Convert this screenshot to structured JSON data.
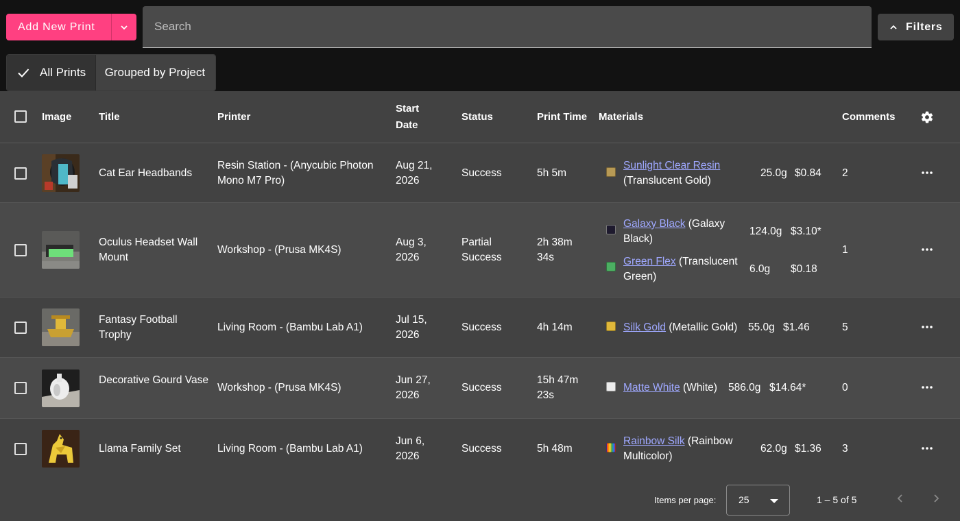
{
  "toolbar": {
    "add_label": "Add New Print",
    "search_placeholder": "Search",
    "filters_label": "Filters"
  },
  "view_toggle": {
    "all_label": "All Prints",
    "grouped_label": "Grouped by Project",
    "selected": "All Prints"
  },
  "table": {
    "headers": {
      "image": "Image",
      "title": "Title",
      "printer": "Printer",
      "start_date_line1": "Start",
      "start_date_line2": "Date",
      "status": "Status",
      "print_time": "Print Time",
      "materials": "Materials",
      "comments": "Comments"
    },
    "rows": [
      {
        "title": "Cat Ear Headbands",
        "printer": "Resin Station - (Anycubic Photon Mono M7 Pro)",
        "start_date": "Aug 21, 2026",
        "status": "Success",
        "print_time": "5h 5m",
        "materials": [
          {
            "name": "Sunlight Clear Resin",
            "detail": "(Translucent Gold)",
            "weight": "25.0g",
            "cost": "$0.84",
            "color": "#b89a55"
          }
        ],
        "comments": "2"
      },
      {
        "title": "Oculus Headset Wall Mount",
        "printer": "Workshop - (Prusa MK4S)",
        "start_date": "Aug 3, 2026",
        "status": "Partial Success",
        "print_time": "2h 38m 34s",
        "materials": [
          {
            "name": "Galaxy Black",
            "detail": "(Galaxy Black)",
            "weight": "124.0g",
            "cost": "$3.10*",
            "color": "#1e1a2e"
          },
          {
            "name": "Green Flex",
            "detail": "(Translucent Green)",
            "weight": "6.0g",
            "cost": "$0.18",
            "color": "#4caf62"
          }
        ],
        "comments": "1"
      },
      {
        "title": "Fantasy Football Trophy",
        "printer": "Living Room - (Bambu Lab A1)",
        "start_date": "Jul 15, 2026",
        "status": "Success",
        "print_time": "4h 14m",
        "materials": [
          {
            "name": "Silk Gold",
            "detail": "(Metallic Gold)",
            "weight": "55.0g",
            "cost": "$1.46",
            "color": "#e0b83a"
          }
        ],
        "comments": "5"
      },
      {
        "title": "Decorative Gourd Vase",
        "printer": "Workshop - (Prusa MK4S)",
        "start_date": "Jun 27, 2026",
        "status": "Success",
        "print_time": "15h 47m 23s",
        "materials": [
          {
            "name": "Matte White",
            "detail": "(White)",
            "weight": "586.0g",
            "cost": "$14.64*",
            "color": "#ececec"
          }
        ],
        "comments": "0"
      },
      {
        "title": "Llama Family Set",
        "printer": "Living Room - (Bambu Lab A1)",
        "start_date": "Jun 6, 2026",
        "status": "Success",
        "print_time": "5h 48m",
        "materials": [
          {
            "name": "Rainbow Silk",
            "detail": "(Rainbow Multicolor)",
            "weight": "62.0g",
            "cost": "$1.36",
            "color": "rainbow"
          }
        ],
        "comments": "3"
      }
    ]
  },
  "pagination": {
    "items_per_page_label": "Items per page:",
    "items_per_page": "25",
    "range": "1 – 5 of 5"
  },
  "colors": {
    "accent": "#ff4081",
    "link": "#9fa8ff",
    "background": "#121212",
    "table_bg": "#424242"
  }
}
